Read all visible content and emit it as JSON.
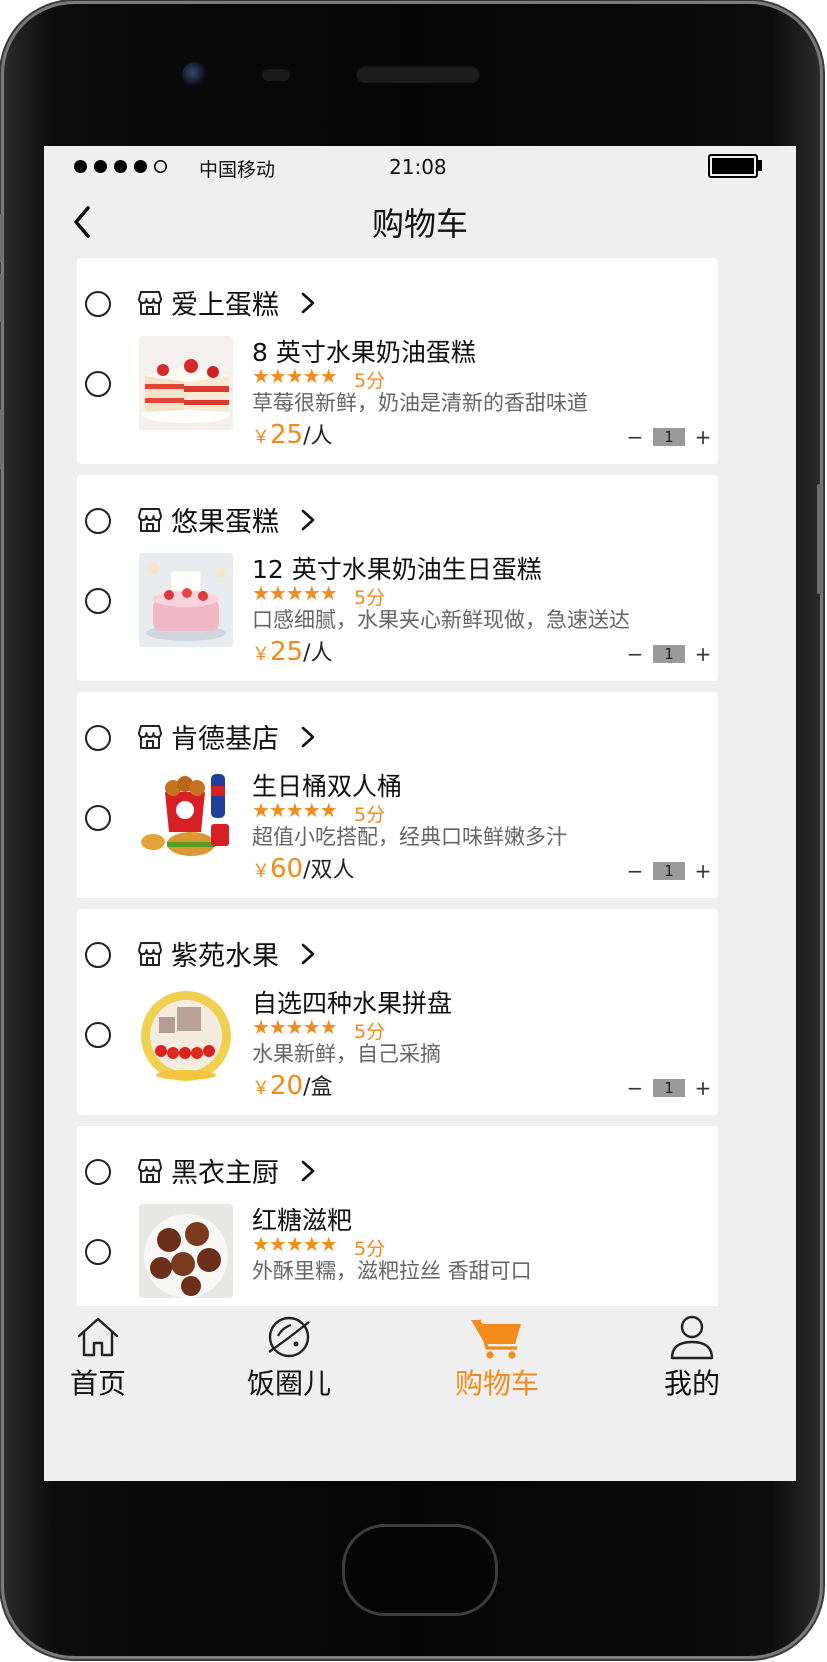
{
  "status_bar": {
    "carrier": "中国移动",
    "time": "21:08"
  },
  "nav": {
    "title": "购物车"
  },
  "cart": [
    {
      "store": "爱上蛋糕",
      "title": "8 英寸水果奶油蛋糕",
      "stars": "★★★★★",
      "score": "5分",
      "desc": "草莓很新鲜，奶油是清新的香甜味道",
      "currency": "￥",
      "price": "25",
      "unit": "/人",
      "quantity": "1",
      "minus": "−",
      "plus": "+"
    },
    {
      "store": "悠果蛋糕",
      "title": "12 英寸水果奶油生日蛋糕",
      "stars": "★★★★★",
      "score": "5分",
      "desc": "口感细腻，水果夹心新鲜现做，急速送达",
      "currency": "￥",
      "price": "25",
      "unit": "/人",
      "quantity": "1",
      "minus": "−",
      "plus": "+"
    },
    {
      "store": "肯德基店",
      "title": "生日桶双人桶",
      "stars": "★★★★★",
      "score": "5分",
      "desc": "超值小吃搭配，经典口味鲜嫩多汁",
      "currency": "￥",
      "price": "60",
      "unit": "/双人",
      "quantity": "1",
      "minus": "−",
      "plus": "+"
    },
    {
      "store": "紫苑水果",
      "title": "自选四种水果拼盘",
      "stars": "★★★★★",
      "score": "5分",
      "desc": "水果新鲜，自己采摘",
      "currency": "￥",
      "price": "20",
      "unit": "/盒",
      "quantity": "1",
      "minus": "−",
      "plus": "+"
    },
    {
      "store": "黑衣主厨",
      "title": "红糖滋粑",
      "stars": "★★★★★",
      "score": "5分",
      "desc": "外酥里糯，滋粑拉丝 香甜可口"
    }
  ],
  "tabs": [
    {
      "label": "首页",
      "icon": "home-icon"
    },
    {
      "label": "饭圈儿",
      "icon": "planet-icon"
    },
    {
      "label": "购物车",
      "icon": "cart-icon",
      "active": true
    },
    {
      "label": "我的",
      "icon": "user-icon"
    }
  ],
  "colors": {
    "accent": "#f28b1b",
    "background": "#efefef",
    "card": "#ffffff"
  }
}
